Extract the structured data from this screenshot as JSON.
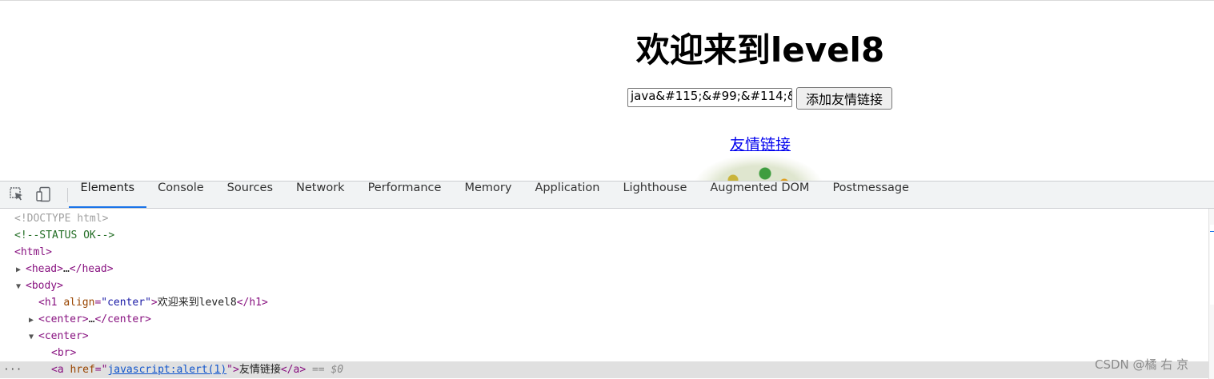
{
  "page": {
    "heading": "欢迎来到level8",
    "input_value": "java&#115;&#99;&#114;&#",
    "button_label": "添加友情链接",
    "link_text": "友情链接"
  },
  "devtools": {
    "tabs": [
      "Elements",
      "Console",
      "Sources",
      "Network",
      "Performance",
      "Memory",
      "Application",
      "Lighthouse",
      "Augmented DOM",
      "Postmessage"
    ],
    "active_tab": "Elements",
    "dom": {
      "doctype": "<!DOCTYPE html>",
      "comment": "<!--STATUS OK-->",
      "html_open": "<html>",
      "head_open": "<head>",
      "ellipsis": "…",
      "head_close": "</head>",
      "body_open": "<body>",
      "h1_open": "<h1",
      "h1_attr": "align",
      "h1_attr_value": "\"center\"",
      "gt": ">",
      "h1_text": "欢迎来到level8",
      "h1_close": "</h1>",
      "center_open": "<center>",
      "center_close": "</center>",
      "br": "<br>",
      "a_open": "<a",
      "a_attr": "href",
      "a_href": "javascript:alert(1)",
      "a_text": "友情链接",
      "a_close": "</a>",
      "selected_marker": "== $0",
      "row_menu": "···"
    }
  },
  "watermark": "CSDN @橘 右 京"
}
